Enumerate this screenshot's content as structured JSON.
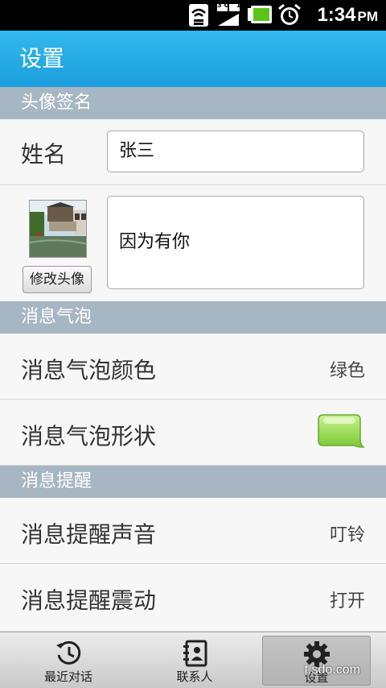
{
  "status_bar": {
    "network": "3G 1X",
    "time": "1:34",
    "ampm": "PM",
    "icons": [
      "wifi-icon",
      "signal-icon",
      "battery-icon",
      "alarm-clock-icon"
    ]
  },
  "header": {
    "title": "设置"
  },
  "sections": {
    "avatar_signature": "头像签名",
    "bubble": "消息气泡",
    "reminder": "消息提醒"
  },
  "profile": {
    "name_label": "姓名",
    "name_value": "张三",
    "change_avatar_label": "修改头像",
    "signature_value": "因为有你"
  },
  "bubble_settings": {
    "color_label": "消息气泡颜色",
    "color_value": "绿色",
    "shape_label": "消息气泡形状",
    "bubble_color": "#8fd14f"
  },
  "reminder_settings": {
    "sound_label": "消息提醒声音",
    "sound_value": "叮铃",
    "vibrate_label": "消息提醒震动",
    "vibrate_value": "打开"
  },
  "tabs": [
    {
      "label": "最近对话",
      "icon": "history-icon"
    },
    {
      "label": "联系人",
      "icon": "contacts-book-icon"
    },
    {
      "label": "设置",
      "icon": "gear-icon",
      "active": true
    }
  ],
  "watermark": "t.sdo.com",
  "colors": {
    "accent": "#1a9fdc",
    "section": "#a7b6c3"
  }
}
